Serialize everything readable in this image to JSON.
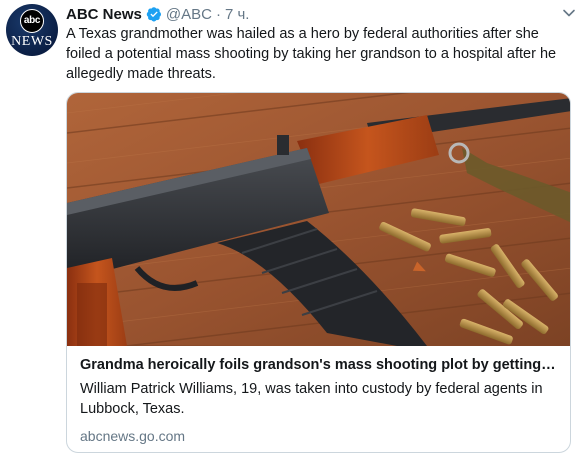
{
  "account": {
    "avatar_logo": "abc",
    "avatar_news": "NEWS",
    "name": "ABC News",
    "handle": "@ABC",
    "separator": "·",
    "time": "7 ч."
  },
  "tweet": {
    "text": "A Texas grandmother was hailed as a hero by federal authorities after she foiled a potential mass shooting by taking her grandson to a hospital after he allegedly made threats."
  },
  "card": {
    "image_icon": "rifle-photo",
    "title": "Grandma heroically foils grandson's mass shooting plot by getting hi...",
    "description": "William Patrick Williams, 19, was taken into custody by federal agents in Lubbock, Texas.",
    "domain": "abcnews.go.com"
  },
  "colors": {
    "verified": "#1da1f2",
    "secondary_text": "#657786",
    "border": "#ccd6dd"
  }
}
